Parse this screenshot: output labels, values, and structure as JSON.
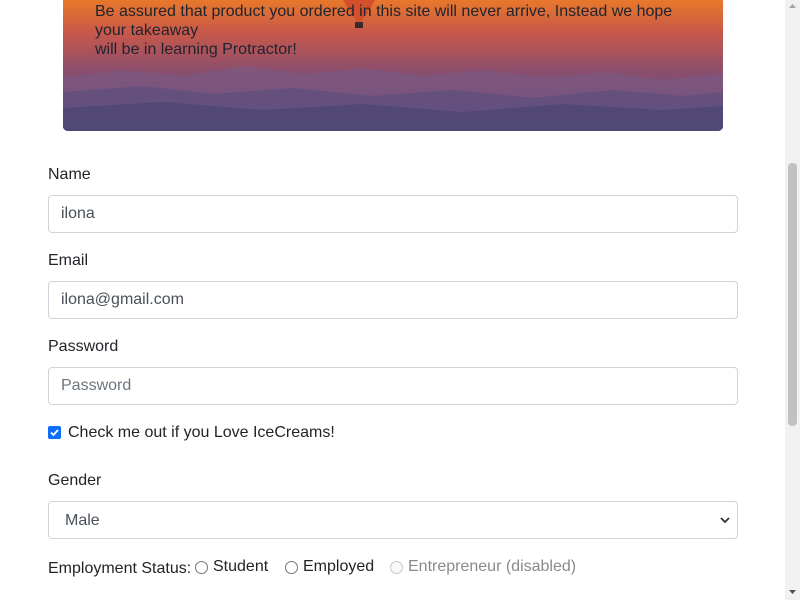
{
  "hero": {
    "line1": "Be assured that product you ordered in this site will never arrive, Instead we hope",
    "line2": "your takeaway",
    "line3": "will be in learning Protractor!"
  },
  "form": {
    "name": {
      "label": "Name",
      "value": "ilona"
    },
    "email": {
      "label": "Email",
      "value": "ilona@gmail.com"
    },
    "password": {
      "label": "Password",
      "value": "",
      "placeholder": "Password"
    },
    "icecream_checkbox": {
      "label": "Check me out if you Love IceCreams!",
      "checked": true
    },
    "gender": {
      "label": "Gender",
      "selected": "Male"
    },
    "employment": {
      "label": "Employment Status:",
      "options": [
        {
          "label": "Student",
          "disabled": false
        },
        {
          "label": "Employed",
          "disabled": false
        },
        {
          "label": "Entrepreneur (disabled)",
          "disabled": true
        }
      ]
    }
  },
  "colors": {
    "accent": "#0d6efd",
    "border": "#ced4da"
  }
}
